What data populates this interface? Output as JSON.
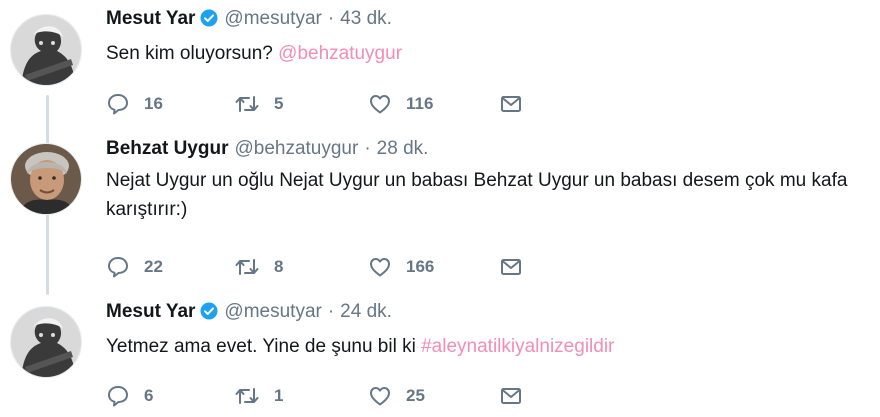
{
  "tweets": [
    {
      "name": "Mesut Yar",
      "verified": true,
      "handle": "@mesutyar",
      "separator": "·",
      "time": "43 dk.",
      "text": "Sen kim oluyorsun? ",
      "link": "@behzatuygur",
      "reply_count": "16",
      "retweet_count": "5",
      "like_count": "116"
    },
    {
      "name": "Behzat Uygur",
      "verified": false,
      "handle": "@behzatuygur",
      "separator": "·",
      "time": "28 dk.",
      "text": "Nejat Uygur un oğlu Nejat Uygur un babası Behzat Uygur un babası desem çok mu kafa karıştırır:)",
      "link": "",
      "reply_count": "22",
      "retweet_count": "8",
      "like_count": "166"
    },
    {
      "name": "Mesut Yar",
      "verified": true,
      "handle": "@mesutyar",
      "separator": "·",
      "time": "24 dk.",
      "text": "Yetmez ama evet. Yine de şunu bil ki ",
      "link": "#aleynatilkiyalnizegildir",
      "reply_count": "6",
      "retweet_count": "1",
      "like_count": "25"
    }
  ],
  "colors": {
    "link": "#f28cb8",
    "secondary": "#657786",
    "verified": "#1da1f2",
    "thread_line": "#d4dde6"
  },
  "icons": [
    "reply-icon",
    "retweet-icon",
    "like-icon",
    "direct-message-icon",
    "verified-badge-icon"
  ]
}
